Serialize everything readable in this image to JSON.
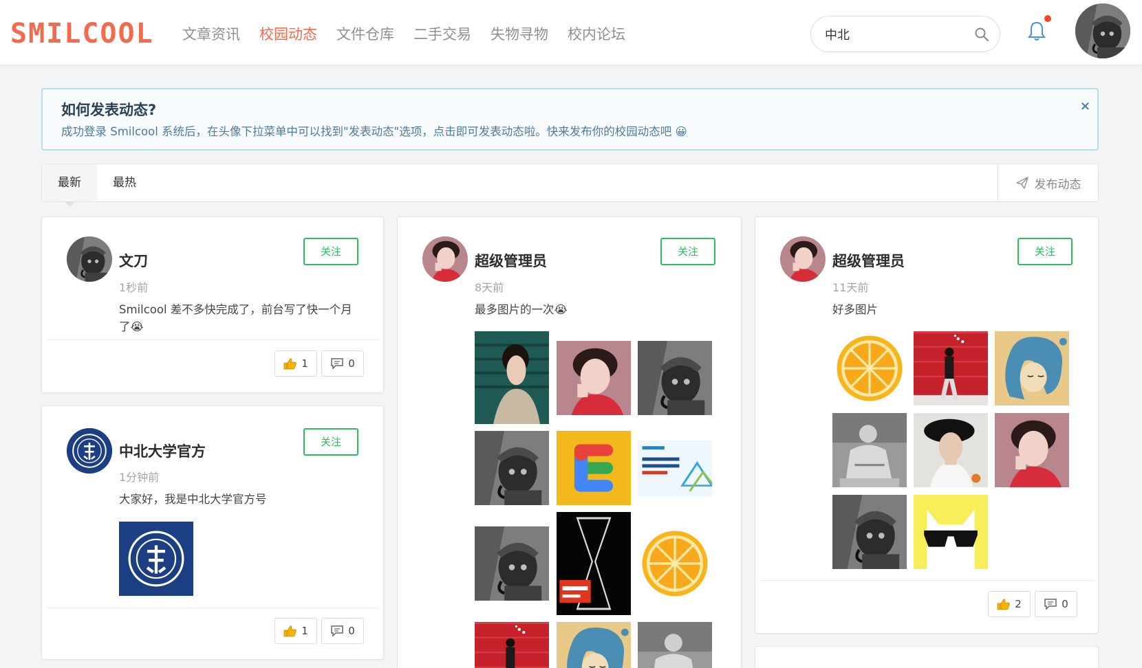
{
  "header": {
    "logo": "SMILCOOL",
    "nav": [
      "文章资讯",
      "校园动态",
      "文件仓库",
      "二手交易",
      "失物寻物",
      "校内论坛"
    ],
    "nav_active": 1,
    "search_value": "中北",
    "icons": [
      "search-icon",
      "bell-icon",
      "avatar"
    ]
  },
  "notice": {
    "title": "如何发表动态?",
    "text": "成功登录 Smilcool 系统后，在头像下拉菜单中可以找到\"发表动态\"选项，点击即可发表动态啦。快来发布你的校园动态吧 😀",
    "close": "×"
  },
  "tabs": {
    "items": [
      "最新",
      "最热"
    ],
    "active": 0,
    "publish_label": "发布动态"
  },
  "posts": [
    {
      "name": "文刀",
      "time": "1秒前",
      "text": "Smilcool 差不多快完成了，前台写了快一个月了😭",
      "follow": "关注",
      "likes": "1",
      "comments": "0"
    },
    {
      "name": "中北大学官方",
      "time": "1分钟前",
      "text": "大家好，我是中北大学官方号",
      "follow": "关注",
      "likes": "1",
      "comments": "0"
    },
    {
      "name": "超级管理员",
      "time": "8天前",
      "text": "最多图片的一次😭",
      "follow": "关注"
    },
    {
      "name": "超级管理员",
      "time": "11天前",
      "text": "好多图片",
      "follow": "关注",
      "likes": "2",
      "comments": "0"
    }
  ],
  "colors": {
    "brand": "#f26b4d",
    "follow_green": "#2fbb60",
    "notice_border": "#b6dde9",
    "notice_text": "#4f7a9c"
  }
}
